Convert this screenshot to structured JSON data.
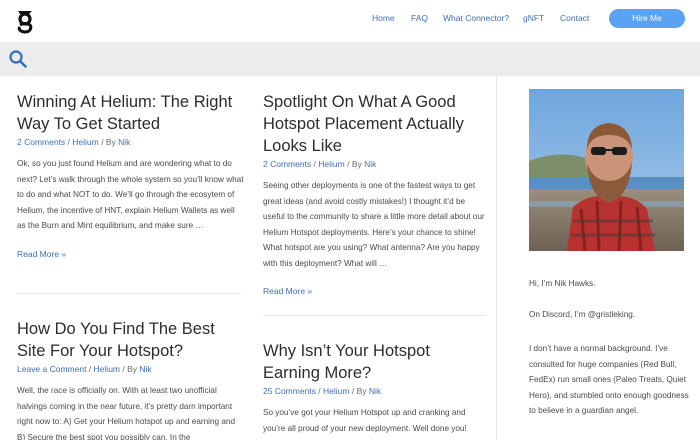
{
  "nav": {
    "items": [
      "Home",
      "FAQ",
      "What Connector?",
      "gNFT",
      "Contact"
    ],
    "cta": "Hire Me"
  },
  "posts": [
    {
      "title": "Winning At Helium: The Right Way To Get Started",
      "comments": "2 Comments",
      "category": "Helium",
      "by": "By",
      "author": "Nik",
      "excerpt": "Ok, so you just found Helium and are wondering what to do next? Let’s walk through the whole system so you’ll know what to do and what NOT to do. We’ll go through the ecosytem of Helium, the incentive of HNT, explain Helium Wallets as well as the Burn and Mint equilibrium, and make sure …",
      "read_more": "Read More »"
    },
    {
      "title": "Spotlight On What A Good Hotspot Placement Actually Looks Like",
      "comments": "2 Comments",
      "category": "Helium",
      "by": "By",
      "author": "Nik",
      "excerpt": "Seeing other deployments is one of the fastest ways to get great ideas (and avoid costly mistakes!)  I thought it’d be useful to the community to share a little more detail about our Helium Hotspot deployments. Here’s your chance to shine! What hotspot are you using? What antenna? Are you happy with this deployment? What will …",
      "read_more": "Read More »"
    },
    {
      "title": "How Do You Find The Best Site For Your Hotspot?",
      "comments": "Leave a Comment",
      "category": "Helium",
      "by": "By",
      "author": "Nik",
      "excerpt": "Well, the race is officially on. With at least two unofficial halvings coming in the near future, it’s pretty darn important right now to: A) Get your Helium hotspot up and earning and  B) Secure the best spot you possibly can. In the"
    },
    {
      "title": "Why Isn’t Your Hotspot Earning More?",
      "comments": "25 Comments",
      "category": "Helium",
      "by": "By",
      "author": "Nik",
      "excerpt": "So you’ve got your Helium Hotspot up and cranking and you’re all proud of your new deployment. Well done you!"
    }
  ],
  "sidebar": {
    "intro": "Hi, I’m Nik Hawks.",
    "discord": "On Discord, I’m @gristleking.",
    "bio": "I don’t have a normal background. I’ve consulted for huge companies (Red Bull, FedEx) run small ones (Paleo Treats, Quiet Hero), and stumbled onto enough goodness to believe in a guardian angel."
  },
  "colors": {
    "link": "#3f6fb5",
    "cta_bg": "#5aa2f2",
    "search_bg": "#ececec"
  }
}
